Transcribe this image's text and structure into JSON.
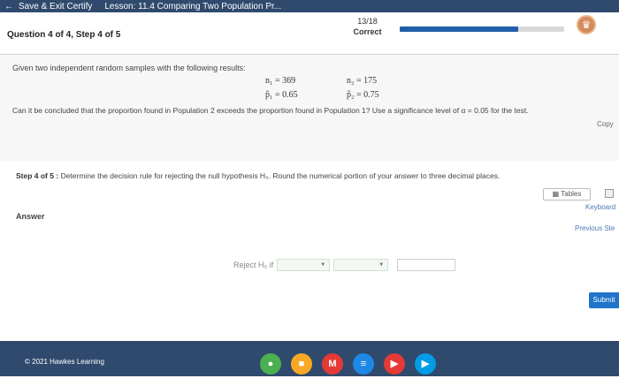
{
  "topbar": {
    "back_glyph": "←",
    "exit_label": "Save & Exit Certify",
    "lesson_label": "Lesson: 11.4 Comparing Two Population Pr..."
  },
  "header": {
    "question_step": "Question 4 of 4, Step 4 of 5",
    "score": "13/18",
    "status": "Correct",
    "progress_fraction": 0.72,
    "badge_glyph": "♛"
  },
  "problem": {
    "intro": "Given two independent random samples with the following results:",
    "stats": {
      "n1": "n₁ = 369",
      "n2": "n₂ = 175",
      "p1": "p̂₁ = 0.65",
      "p2": "p̂₂ = 0.75"
    },
    "question": "Can it be concluded that the proportion found in Population 2 exceeds the proportion found in Population 1? Use a significance level of α = 0.05 for the test.",
    "copy_label": "Copy"
  },
  "step": {
    "label": "Step 4 of 5 :",
    "text": "Determine the decision rule for rejecting the null hypothesis H₀. Round the numerical portion of your answer to three decimal places.",
    "tables_label": "Tables",
    "keyboard_label": "Keyboard",
    "answer_label": "Answer",
    "previous_steps_label": "Previous Ste"
  },
  "answer": {
    "reject_label": "Reject H₀ if",
    "dropdown1_value": "",
    "dropdown2_value": "",
    "number_value": "",
    "submit_label": "Submit"
  },
  "footer": {
    "copyright": "© 2021 Hawkes Learning"
  },
  "dock_apps": [
    {
      "name": "chrome-icon",
      "color": "#4caf50",
      "glyph": "●"
    },
    {
      "name": "slides-icon",
      "color": "#f9a825",
      "glyph": "■"
    },
    {
      "name": "gmail-icon",
      "color": "#e53935",
      "glyph": "M"
    },
    {
      "name": "docs-icon",
      "color": "#1e88e5",
      "glyph": "≡"
    },
    {
      "name": "youtube-icon",
      "color": "#e53935",
      "glyph": "▶"
    },
    {
      "name": "play-icon",
      "color": "#039be5",
      "glyph": "▶"
    }
  ]
}
